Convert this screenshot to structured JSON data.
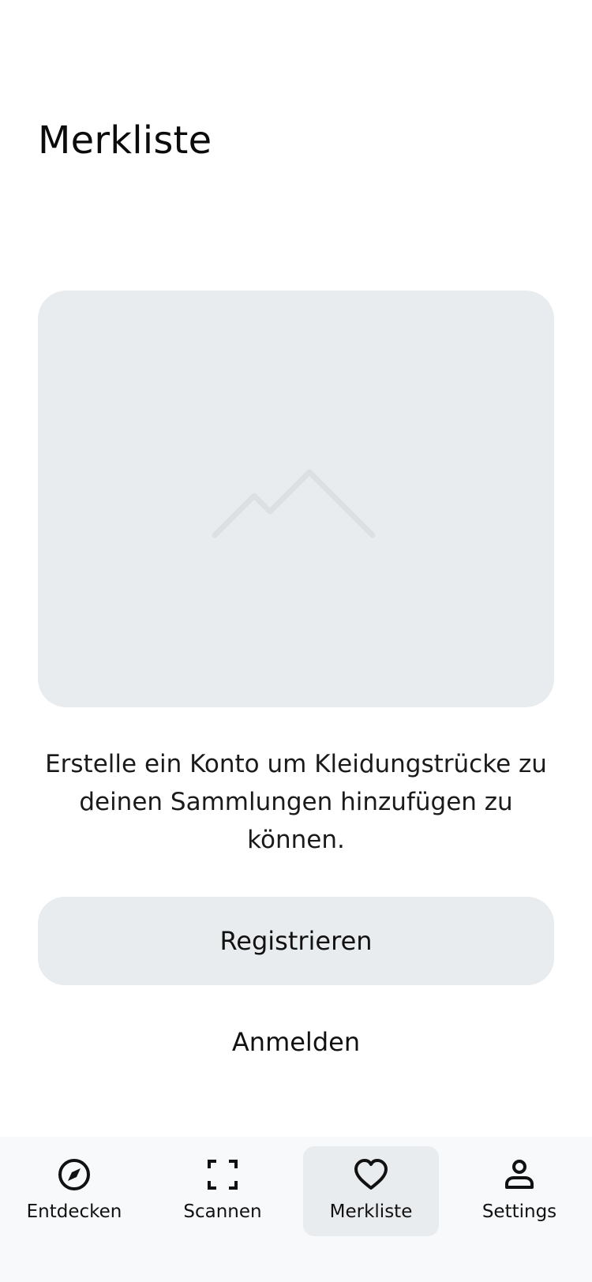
{
  "header": {
    "title": "Merkliste"
  },
  "empty_state": {
    "image_icon": "image-placeholder-icon",
    "message": "Erstelle ein Konto um Kleidungstrücke zu deinen Sammlungen hinzufügen zu können."
  },
  "actions": {
    "register_label": "Registrieren",
    "login_label": "Anmelden"
  },
  "tab_bar": {
    "items": [
      {
        "label": "Entdecken",
        "icon": "compass-icon",
        "active": false
      },
      {
        "label": "Scannen",
        "icon": "scan-icon",
        "active": false
      },
      {
        "label": "Merkliste",
        "icon": "heart-icon",
        "active": true
      },
      {
        "label": "Settings",
        "icon": "person-icon",
        "active": false
      }
    ]
  },
  "colors": {
    "placeholder_background": "#e9ecef",
    "tab_bar_background": "#f8f9fa",
    "active_tab_background": "#e9ecef",
    "text": "#111111"
  }
}
